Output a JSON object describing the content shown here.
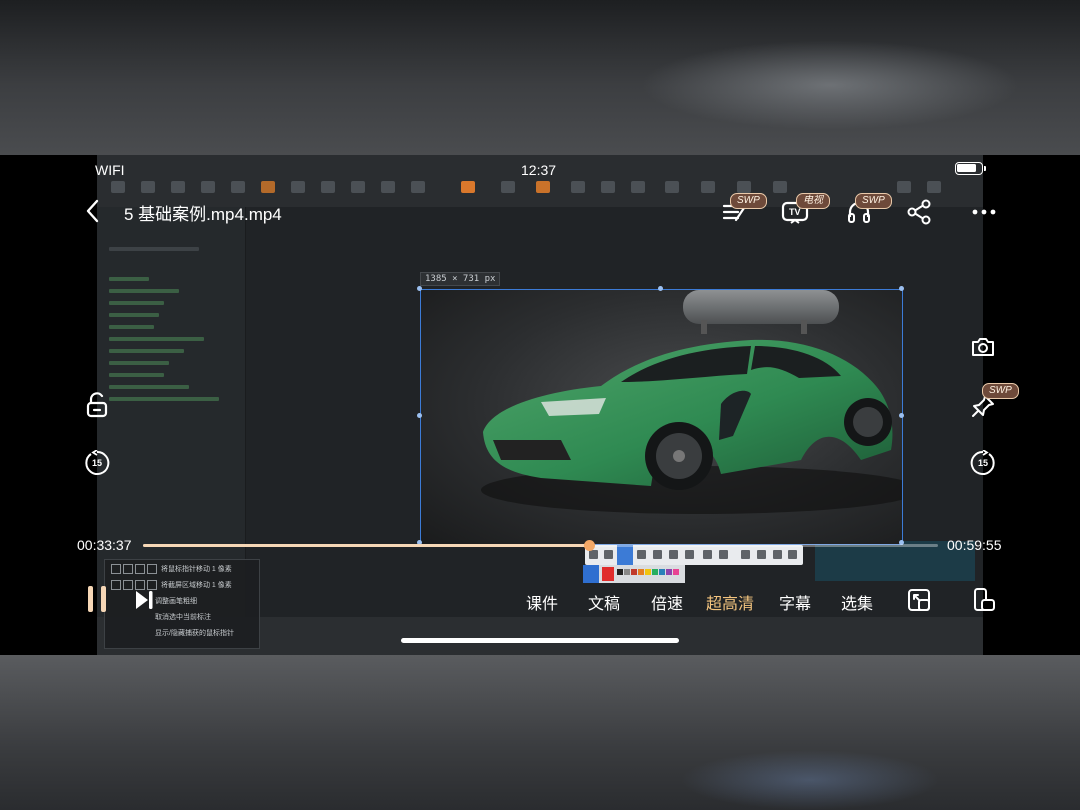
{
  "status_bar": {
    "network": "WIFI",
    "time": "12:37",
    "battery": "battery-full-icon"
  },
  "player": {
    "title": "5 基础案例.mp4.mp4",
    "elapsed": "00:33:37",
    "duration": "00:59:55",
    "progress": 0.561,
    "top_controls": [
      {
        "name": "notes-button",
        "icon": "notes-icon",
        "badge": "SWP"
      },
      {
        "name": "tv-cast-button",
        "icon": "tv-icon",
        "badge": "电视"
      },
      {
        "name": "audio-button",
        "icon": "headphones-icon",
        "badge": "SWP"
      },
      {
        "name": "share-button",
        "icon": "share-icon"
      },
      {
        "name": "more-button",
        "icon": "more-icon"
      }
    ],
    "side_controls": {
      "lock": "lock-icon",
      "rewind": "15",
      "forward": "15",
      "screenshot": "camera-icon",
      "pin_badge": "SWP"
    },
    "bottom_menu": [
      {
        "label": "课件",
        "active": false
      },
      {
        "label": "文稿",
        "active": false
      },
      {
        "label": "倍速",
        "active": false
      },
      {
        "label": "超高清",
        "active": true
      },
      {
        "label": "字幕",
        "active": false
      },
      {
        "label": "选集",
        "active": false
      }
    ],
    "colors": {
      "accent": "#f3c47f",
      "progress_thumb": "#f3a867",
      "badge_bg": "#6e4a3a"
    }
  },
  "video_frame": {
    "size_label": "1385 × 731  px",
    "shortcuts": [
      {
        "keys": "W A S D",
        "text": "将鼠标指针移动 1 像素"
      },
      {
        "keys": "↑ ↓ ← →",
        "text": "将截屏区域移动 1 像素"
      },
      {
        "keys": "",
        "text": "调整画笔粗细"
      },
      {
        "keys": "",
        "text": "取消选中当前标注"
      },
      {
        "keys": "",
        "text": "显示/隐藏捕获的鼠标指针"
      }
    ]
  }
}
